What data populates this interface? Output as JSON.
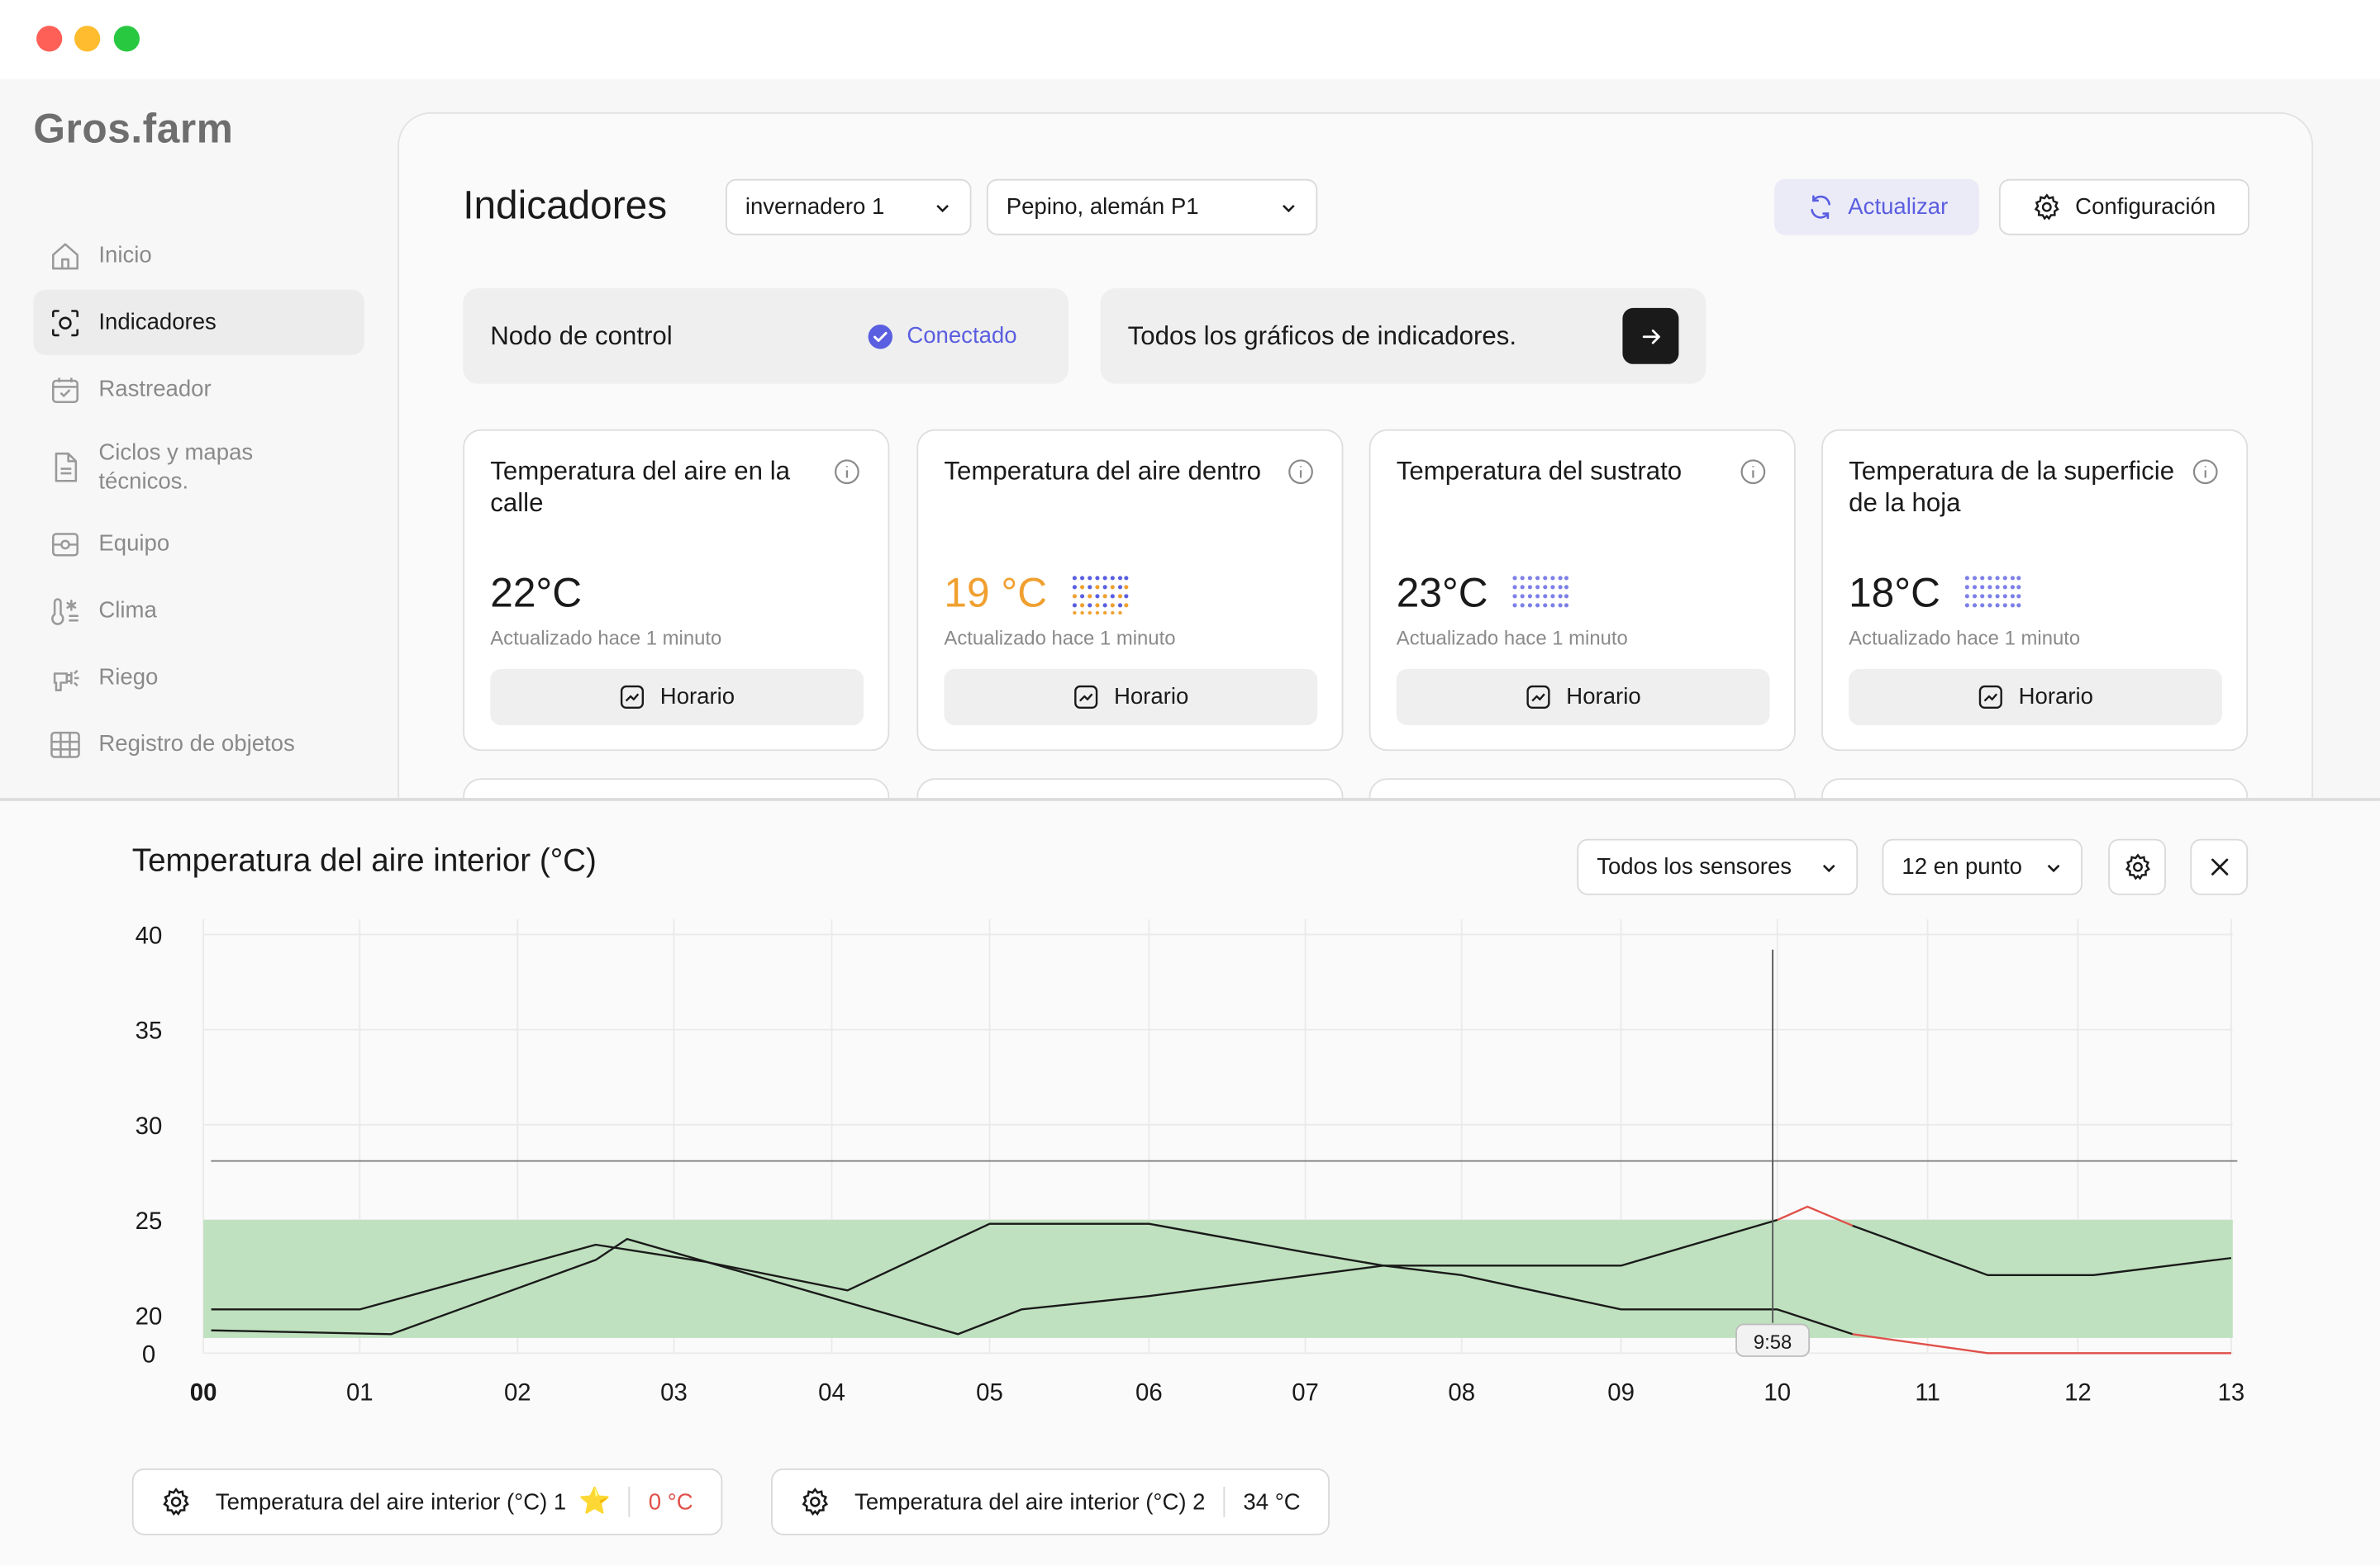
{
  "app": {
    "logo": "Gros.farm"
  },
  "sidebar": {
    "items": [
      {
        "label": "Inicio",
        "icon": "home-icon",
        "active": false
      },
      {
        "label": "Indicadores",
        "icon": "indicators-icon",
        "active": true
      },
      {
        "label": "Rastreador",
        "icon": "calendar-check-icon",
        "active": false
      },
      {
        "label": "Ciclos y mapas técnicos.",
        "icon": "document-icon",
        "active": false
      },
      {
        "label": "Equipo",
        "icon": "equipment-icon",
        "active": false
      },
      {
        "label": "Clima",
        "icon": "thermometer-icon",
        "active": false
      },
      {
        "label": "Riego",
        "icon": "irrigation-icon",
        "active": false
      },
      {
        "label": "Registro de objetos",
        "icon": "grid-icon",
        "active": false
      }
    ]
  },
  "header": {
    "title": "Indicadores",
    "greenhouse_select": "invernadero 1",
    "crop_select": "Pepino, alemán P1",
    "update_label": "Actualizar",
    "config_label": "Configuración"
  },
  "status": {
    "node_label": "Nodo de control",
    "node_status": "Conectado",
    "all_charts_label": "Todos los gráficos de indicadores."
  },
  "cards": [
    {
      "title": "Temperatura del aire en la calle",
      "value": "22°C",
      "updated": "Actualizado hace 1 minuto",
      "button": "Horario",
      "warn": false,
      "dots": false
    },
    {
      "title": "Temperatura del aire dentro",
      "value": "19 °C",
      "updated": "Actualizado hace 1 minuto",
      "button": "Horario",
      "warn": true,
      "dots": true
    },
    {
      "title": "Temperatura del sustrato",
      "value": "23°C",
      "updated": "Actualizado hace 1 minuto",
      "button": "Horario",
      "warn": false,
      "dots": true
    },
    {
      "title": "Temperatura de la superficie de la hoja",
      "value": "18°C",
      "updated": "Actualizado hace 1 minuto",
      "button": "Horario",
      "warn": false,
      "dots": true
    }
  ],
  "colors": {
    "accent": "#5a5ee0",
    "warning": "#f0a030",
    "band": "#bfe1bf",
    "alert_line": "#e0504a"
  },
  "detail": {
    "title": "Temperatura del aire interior (°C)",
    "sensors_select": "Todos los sensores",
    "hours_select": "12 en punto",
    "cursor_label": "9:58",
    "legend": [
      {
        "label": "Temperatura del aire interior (°C) 1",
        "starred": true,
        "value": "0 °C",
        "alert": true
      },
      {
        "label": "Temperatura del aire interior (°C) 2",
        "starred": false,
        "value": "34 °C",
        "alert": false
      }
    ]
  },
  "chart_data": {
    "type": "line",
    "title": "Temperatura del aire interior (°C)",
    "xlabel": "",
    "ylabel": "",
    "x_ticks": [
      "00",
      "01",
      "02",
      "03",
      "04",
      "05",
      "06",
      "07",
      "08",
      "09",
      "10",
      "11",
      "12",
      "13"
    ],
    "y_ticks": [
      0,
      20,
      25,
      30,
      35,
      40
    ],
    "y_tick_values": [
      18,
      20,
      25,
      30,
      35,
      40
    ],
    "ylim": [
      18,
      40
    ],
    "xlim": [
      0,
      13
    ],
    "grid": true,
    "optimal_band": [
      18.8,
      25
    ],
    "threshold_line": 28.1,
    "cursor_x": 9.97,
    "series": [
      {
        "x": [
          0.05,
          1.0,
          2.5,
          3.2,
          4.1,
          5.0,
          6.0,
          7.0,
          7.5,
          8.0,
          9.0,
          10.0,
          10.2,
          10.5,
          11.4,
          12.1,
          13.0
        ],
        "y": [
          20.3,
          20.3,
          23.7,
          22.8,
          21.3,
          24.8,
          24.8,
          23.3,
          22.6,
          22.6,
          22.6,
          25.0,
          25.7,
          24.7,
          22.1,
          22.1,
          23.0
        ],
        "alert_from_x": 10.0,
        "alert_to_x": 10.5
      },
      {
        "x": [
          0.05,
          1.2,
          2.5,
          2.7,
          4.8,
          5.2,
          6.0,
          7.5,
          8.0,
          9.0,
          10.0,
          10.5,
          11.4,
          13.0
        ],
        "y": [
          19.2,
          19.0,
          22.9,
          24.0,
          19.0,
          20.3,
          21.0,
          22.6,
          22.1,
          20.3,
          20.3,
          19.0,
          18.0,
          18.0
        ],
        "alert_from_x": 10.5,
        "alert_to_x": 13.0
      }
    ]
  }
}
